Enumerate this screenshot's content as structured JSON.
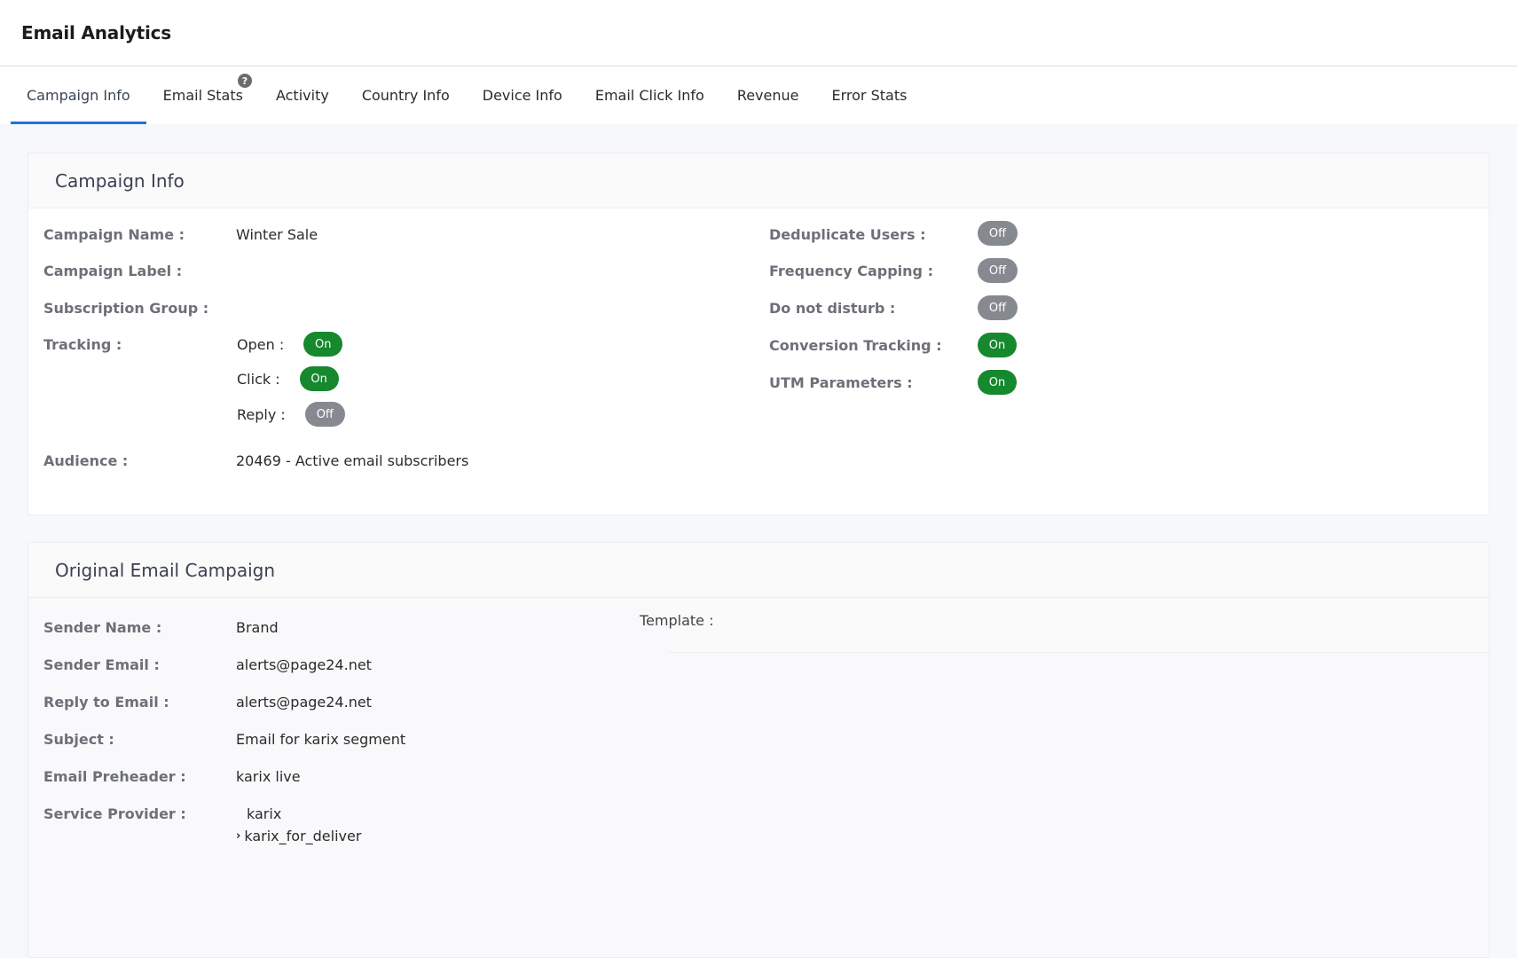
{
  "app": {
    "title": "Email Analytics"
  },
  "tabs": [
    {
      "label": "Campaign Info",
      "active": true
    },
    {
      "label": "Email Stats",
      "help": "?"
    },
    {
      "label": "Activity"
    },
    {
      "label": "Country Info"
    },
    {
      "label": "Device Info"
    },
    {
      "label": "Email Click Info"
    },
    {
      "label": "Revenue"
    },
    {
      "label": "Error Stats"
    }
  ],
  "campaign_info": {
    "title": "Campaign Info",
    "campaign_name_label": "Campaign Name :",
    "campaign_name": "Winter Sale",
    "campaign_label_label": "Campaign Label :",
    "subscription_group_label": "Subscription Group :",
    "tracking_label": "Tracking :",
    "tracking": {
      "open_label": "Open :",
      "open": "On",
      "click_label": "Click :",
      "click": "On",
      "reply_label": "Reply :",
      "reply": "Off"
    },
    "audience_label": "Audience :",
    "audience": "20469 - Active email subscribers",
    "dedup_label": "Deduplicate Users :",
    "dedup": "Off",
    "freq_label": "Frequency Capping :",
    "freq": "Off",
    "dnd_label": "Do not disturb :",
    "dnd": "Off",
    "conversion_label": "Conversion Tracking :",
    "conversion": "On",
    "utm_label": "UTM Parameters :",
    "utm": "On"
  },
  "original_email": {
    "title": "Original Email Campaign",
    "sender_name_label": "Sender Name :",
    "sender_name": "Brand",
    "sender_email_label": "Sender Email :",
    "sender_email": "alerts@page24.net",
    "reply_email_label": "Reply to Email :",
    "reply_email": "alerts@page24.net",
    "subject_label": "Subject :",
    "subject": "Email for karix segment",
    "preheader_label": "Email Preheader :",
    "preheader": "karix live",
    "provider_label": "Service Provider :",
    "provider": "karix",
    "provider_sub_caret": "›",
    "provider_sub": "karix_for_deliver",
    "template_label": "Template :"
  },
  "colors": {
    "accent": "#1f73d8",
    "on": "#16882e",
    "off": "#868990"
  }
}
